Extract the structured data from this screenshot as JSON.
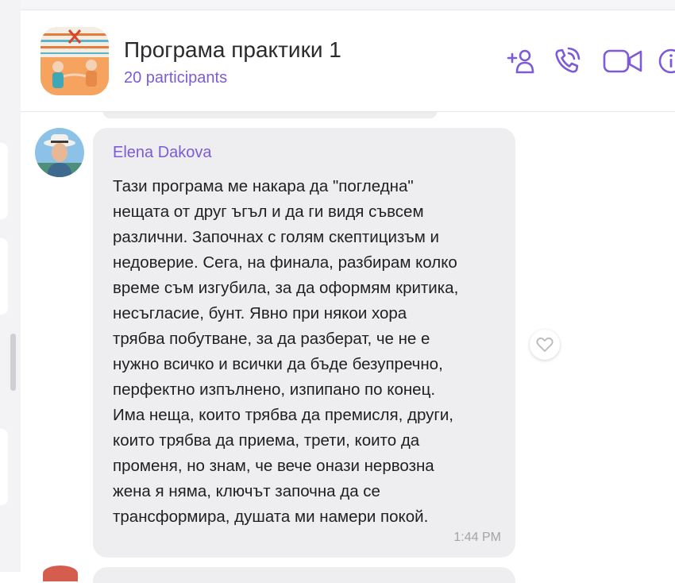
{
  "header": {
    "title": "Програма практики 1",
    "participants": "20 participants",
    "accent_color": "#7e5bd6"
  },
  "message": {
    "sender": "Elena Dakova",
    "lines": [
      "Тази програма ме накара да \"погледна\"",
      "нещата от друг ъгъл и да ги видя съвсем",
      "различни. Започнах с голям скептицизъм и",
      "недоверие. Сега, на финала, разбирам колко",
      "време съм изгубила, за да оформям критика,",
      "несъгласие, бунт. Явно при някои хора",
      "трябва побутване, за да разберат, че не е",
      "нужно всичко и всички да бъде безупречно,",
      "перфектно изпълнено, изпипано по конец.",
      "Има неща, които трябва да премисля, други,",
      "които трябва да приема, трети, които да",
      "променя, но знам, че вече онази нервозна",
      "жена я няма, ключът започна да се",
      "трансформира, душата ми намери покой."
    ],
    "time": "1:44 PM"
  },
  "icons": {
    "add_participant": "add-person-icon",
    "call": "phone-icon",
    "video": "video-camera-icon",
    "info": "info-icon",
    "like": "heart-icon"
  }
}
